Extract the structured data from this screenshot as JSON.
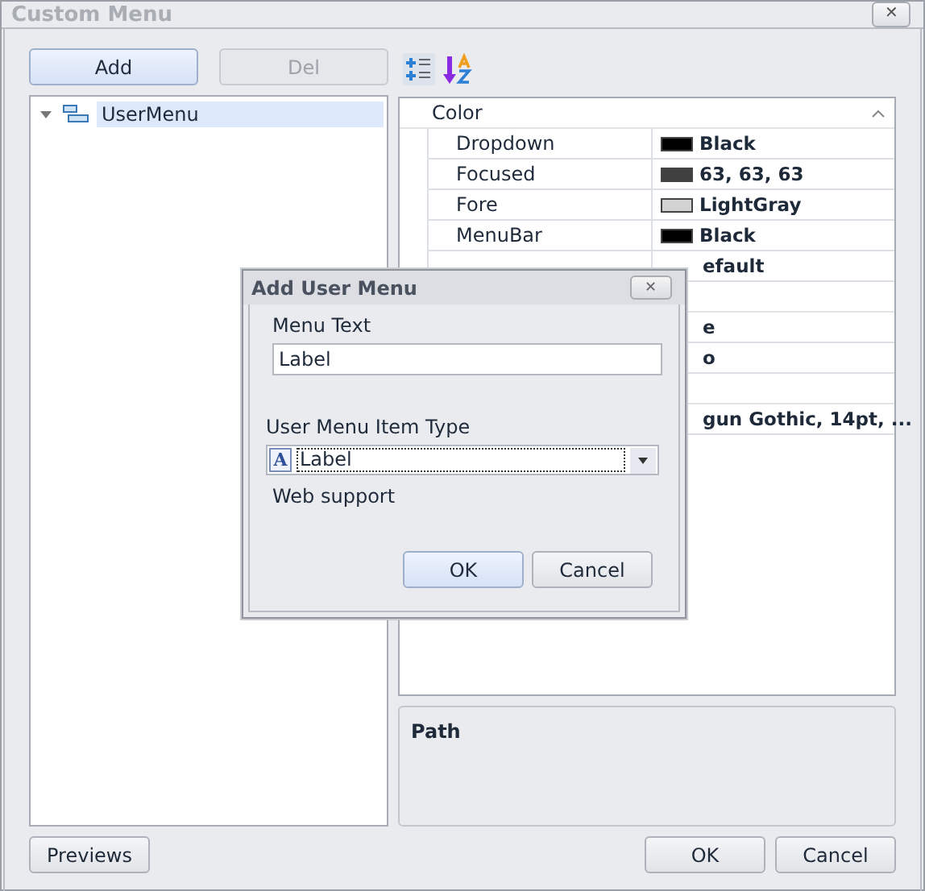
{
  "window": {
    "title": "Custom Menu",
    "close": "✕"
  },
  "left_buttons": [
    {
      "label": "Add",
      "disabled": false
    },
    {
      "label": "Del",
      "disabled": true
    }
  ],
  "tree": [
    {
      "label": "UserMenu",
      "expanded": true,
      "selected": true
    }
  ],
  "grid": [
    {
      "category": "Color",
      "rows": [
        {
          "name": "Dropdown",
          "color": "#000000",
          "value": "Black"
        },
        {
          "name": "Focused",
          "color": "#3f3f3f",
          "value": "63, 63, 63"
        },
        {
          "name": "Fore",
          "color": "#d3d3d3",
          "value": "LightGray"
        },
        {
          "name": "MenuBar",
          "color": "#000000",
          "value": "Black"
        },
        {
          "value": "efault"
        }
      ]
    },
    {
      "rows": [
        {
          "value": "e"
        },
        {
          "value": "o"
        }
      ]
    },
    {
      "rows": [
        {
          "value": "gun Gothic, 14pt, ..."
        }
      ]
    }
  ],
  "description": {
    "title": "Path"
  },
  "previews_button": "Previews",
  "footer_buttons": [
    "OK",
    "Cancel"
  ],
  "dialog": {
    "title": "Add User Menu",
    "close": "✕",
    "menu_text_label": "Menu Text",
    "menu_text_value": "Label",
    "type_label": "User Menu Item Type",
    "type_icon": "A",
    "type_value": "Label",
    "web_support": "Web support",
    "buttons": [
      {
        "label": "OK",
        "default": true
      },
      {
        "label": "Cancel",
        "default": false
      }
    ]
  }
}
